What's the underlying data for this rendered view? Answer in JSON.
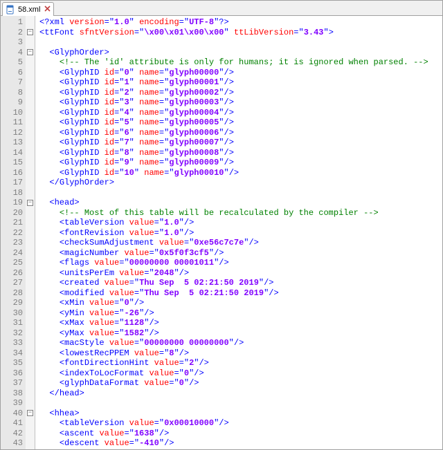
{
  "tab": {
    "filename": "58.xml",
    "icon": "xml-file-icon"
  },
  "code_lines": [
    {
      "n": 1,
      "fold": "",
      "type": "pi",
      "indent": 0,
      "text": "<?xml version=\"1.0\" encoding=\"UTF-8\"?>"
    },
    {
      "n": 2,
      "fold": "-",
      "type": "open",
      "indent": 0,
      "tag": "ttFont",
      "attrs": [
        [
          "sfntVersion",
          "\\x00\\x01\\x00\\x00"
        ],
        [
          "ttLibVersion",
          "3.43"
        ]
      ]
    },
    {
      "n": 3,
      "fold": "",
      "type": "blank"
    },
    {
      "n": 4,
      "fold": "-",
      "type": "open",
      "indent": 1,
      "tag": "GlyphOrder"
    },
    {
      "n": 5,
      "fold": "",
      "type": "cmt",
      "indent": 2,
      "text": "<!-- The 'id' attribute is only for humans; it is ignored when parsed. -->"
    },
    {
      "n": 6,
      "fold": "",
      "type": "self",
      "indent": 2,
      "tag": "GlyphID",
      "attrs": [
        [
          "id",
          "0"
        ],
        [
          "name",
          "glyph00000"
        ]
      ]
    },
    {
      "n": 7,
      "fold": "",
      "type": "self",
      "indent": 2,
      "tag": "GlyphID",
      "attrs": [
        [
          "id",
          "1"
        ],
        [
          "name",
          "glyph00001"
        ]
      ]
    },
    {
      "n": 8,
      "fold": "",
      "type": "self",
      "indent": 2,
      "tag": "GlyphID",
      "attrs": [
        [
          "id",
          "2"
        ],
        [
          "name",
          "glyph00002"
        ]
      ]
    },
    {
      "n": 9,
      "fold": "",
      "type": "self",
      "indent": 2,
      "tag": "GlyphID",
      "attrs": [
        [
          "id",
          "3"
        ],
        [
          "name",
          "glyph00003"
        ]
      ]
    },
    {
      "n": 10,
      "fold": "",
      "type": "self",
      "indent": 2,
      "tag": "GlyphID",
      "attrs": [
        [
          "id",
          "4"
        ],
        [
          "name",
          "glyph00004"
        ]
      ]
    },
    {
      "n": 11,
      "fold": "",
      "type": "self",
      "indent": 2,
      "tag": "GlyphID",
      "attrs": [
        [
          "id",
          "5"
        ],
        [
          "name",
          "glyph00005"
        ]
      ]
    },
    {
      "n": 12,
      "fold": "",
      "type": "self",
      "indent": 2,
      "tag": "GlyphID",
      "attrs": [
        [
          "id",
          "6"
        ],
        [
          "name",
          "glyph00006"
        ]
      ]
    },
    {
      "n": 13,
      "fold": "",
      "type": "self",
      "indent": 2,
      "tag": "GlyphID",
      "attrs": [
        [
          "id",
          "7"
        ],
        [
          "name",
          "glyph00007"
        ]
      ]
    },
    {
      "n": 14,
      "fold": "",
      "type": "self",
      "indent": 2,
      "tag": "GlyphID",
      "attrs": [
        [
          "id",
          "8"
        ],
        [
          "name",
          "glyph00008"
        ]
      ]
    },
    {
      "n": 15,
      "fold": "",
      "type": "self",
      "indent": 2,
      "tag": "GlyphID",
      "attrs": [
        [
          "id",
          "9"
        ],
        [
          "name",
          "glyph00009"
        ]
      ]
    },
    {
      "n": 16,
      "fold": "",
      "type": "self",
      "indent": 2,
      "tag": "GlyphID",
      "attrs": [
        [
          "id",
          "10"
        ],
        [
          "name",
          "glyph00010"
        ]
      ]
    },
    {
      "n": 17,
      "fold": "",
      "type": "close",
      "indent": 1,
      "tag": "GlyphOrder"
    },
    {
      "n": 18,
      "fold": "",
      "type": "blank"
    },
    {
      "n": 19,
      "fold": "-",
      "type": "open",
      "indent": 1,
      "tag": "head"
    },
    {
      "n": 20,
      "fold": "",
      "type": "cmt",
      "indent": 2,
      "text": "<!-- Most of this table will be recalculated by the compiler -->"
    },
    {
      "n": 21,
      "fold": "",
      "type": "self",
      "indent": 2,
      "tag": "tableVersion",
      "attrs": [
        [
          "value",
          "1.0"
        ]
      ]
    },
    {
      "n": 22,
      "fold": "",
      "type": "self",
      "indent": 2,
      "tag": "fontRevision",
      "attrs": [
        [
          "value",
          "1.0"
        ]
      ]
    },
    {
      "n": 23,
      "fold": "",
      "type": "self",
      "indent": 2,
      "tag": "checkSumAdjustment",
      "attrs": [
        [
          "value",
          "0xe56c7c7e"
        ]
      ]
    },
    {
      "n": 24,
      "fold": "",
      "type": "self",
      "indent": 2,
      "tag": "magicNumber",
      "attrs": [
        [
          "value",
          "0x5f0f3cf5"
        ]
      ]
    },
    {
      "n": 25,
      "fold": "",
      "type": "self",
      "indent": 2,
      "tag": "flags",
      "attrs": [
        [
          "value",
          "00000000 00001011"
        ]
      ]
    },
    {
      "n": 26,
      "fold": "",
      "type": "self",
      "indent": 2,
      "tag": "unitsPerEm",
      "attrs": [
        [
          "value",
          "2048"
        ]
      ]
    },
    {
      "n": 27,
      "fold": "",
      "type": "self",
      "indent": 2,
      "tag": "created",
      "attrs": [
        [
          "value",
          "Thu Sep  5 02:21:50 2019"
        ]
      ]
    },
    {
      "n": 28,
      "fold": "",
      "type": "self",
      "indent": 2,
      "tag": "modified",
      "attrs": [
        [
          "value",
          "Thu Sep  5 02:21:50 2019"
        ]
      ]
    },
    {
      "n": 29,
      "fold": "",
      "type": "self",
      "indent": 2,
      "tag": "xMin",
      "attrs": [
        [
          "value",
          "0"
        ]
      ]
    },
    {
      "n": 30,
      "fold": "",
      "type": "self",
      "indent": 2,
      "tag": "yMin",
      "attrs": [
        [
          "value",
          "-26"
        ]
      ]
    },
    {
      "n": 31,
      "fold": "",
      "type": "self",
      "indent": 2,
      "tag": "xMax",
      "attrs": [
        [
          "value",
          "1128"
        ]
      ]
    },
    {
      "n": 32,
      "fold": "",
      "type": "self",
      "indent": 2,
      "tag": "yMax",
      "attrs": [
        [
          "value",
          "1582"
        ]
      ]
    },
    {
      "n": 33,
      "fold": "",
      "type": "self",
      "indent": 2,
      "tag": "macStyle",
      "attrs": [
        [
          "value",
          "00000000 00000000"
        ]
      ]
    },
    {
      "n": 34,
      "fold": "",
      "type": "self",
      "indent": 2,
      "tag": "lowestRecPPEM",
      "attrs": [
        [
          "value",
          "8"
        ]
      ]
    },
    {
      "n": 35,
      "fold": "",
      "type": "self",
      "indent": 2,
      "tag": "fontDirectionHint",
      "attrs": [
        [
          "value",
          "2"
        ]
      ]
    },
    {
      "n": 36,
      "fold": "",
      "type": "self",
      "indent": 2,
      "tag": "indexToLocFormat",
      "attrs": [
        [
          "value",
          "0"
        ]
      ]
    },
    {
      "n": 37,
      "fold": "",
      "type": "self",
      "indent": 2,
      "tag": "glyphDataFormat",
      "attrs": [
        [
          "value",
          "0"
        ]
      ]
    },
    {
      "n": 38,
      "fold": "",
      "type": "close",
      "indent": 1,
      "tag": "head"
    },
    {
      "n": 39,
      "fold": "",
      "type": "blank"
    },
    {
      "n": 40,
      "fold": "-",
      "type": "open",
      "indent": 1,
      "tag": "hhea"
    },
    {
      "n": 41,
      "fold": "",
      "type": "self",
      "indent": 2,
      "tag": "tableVersion",
      "attrs": [
        [
          "value",
          "0x00010000"
        ]
      ]
    },
    {
      "n": 42,
      "fold": "",
      "type": "self",
      "indent": 2,
      "tag": "ascent",
      "attrs": [
        [
          "value",
          "1638"
        ]
      ]
    },
    {
      "n": 43,
      "fold": "",
      "type": "self",
      "indent": 2,
      "tag": "descent",
      "attrs": [
        [
          "value",
          "-410"
        ]
      ]
    }
  ]
}
